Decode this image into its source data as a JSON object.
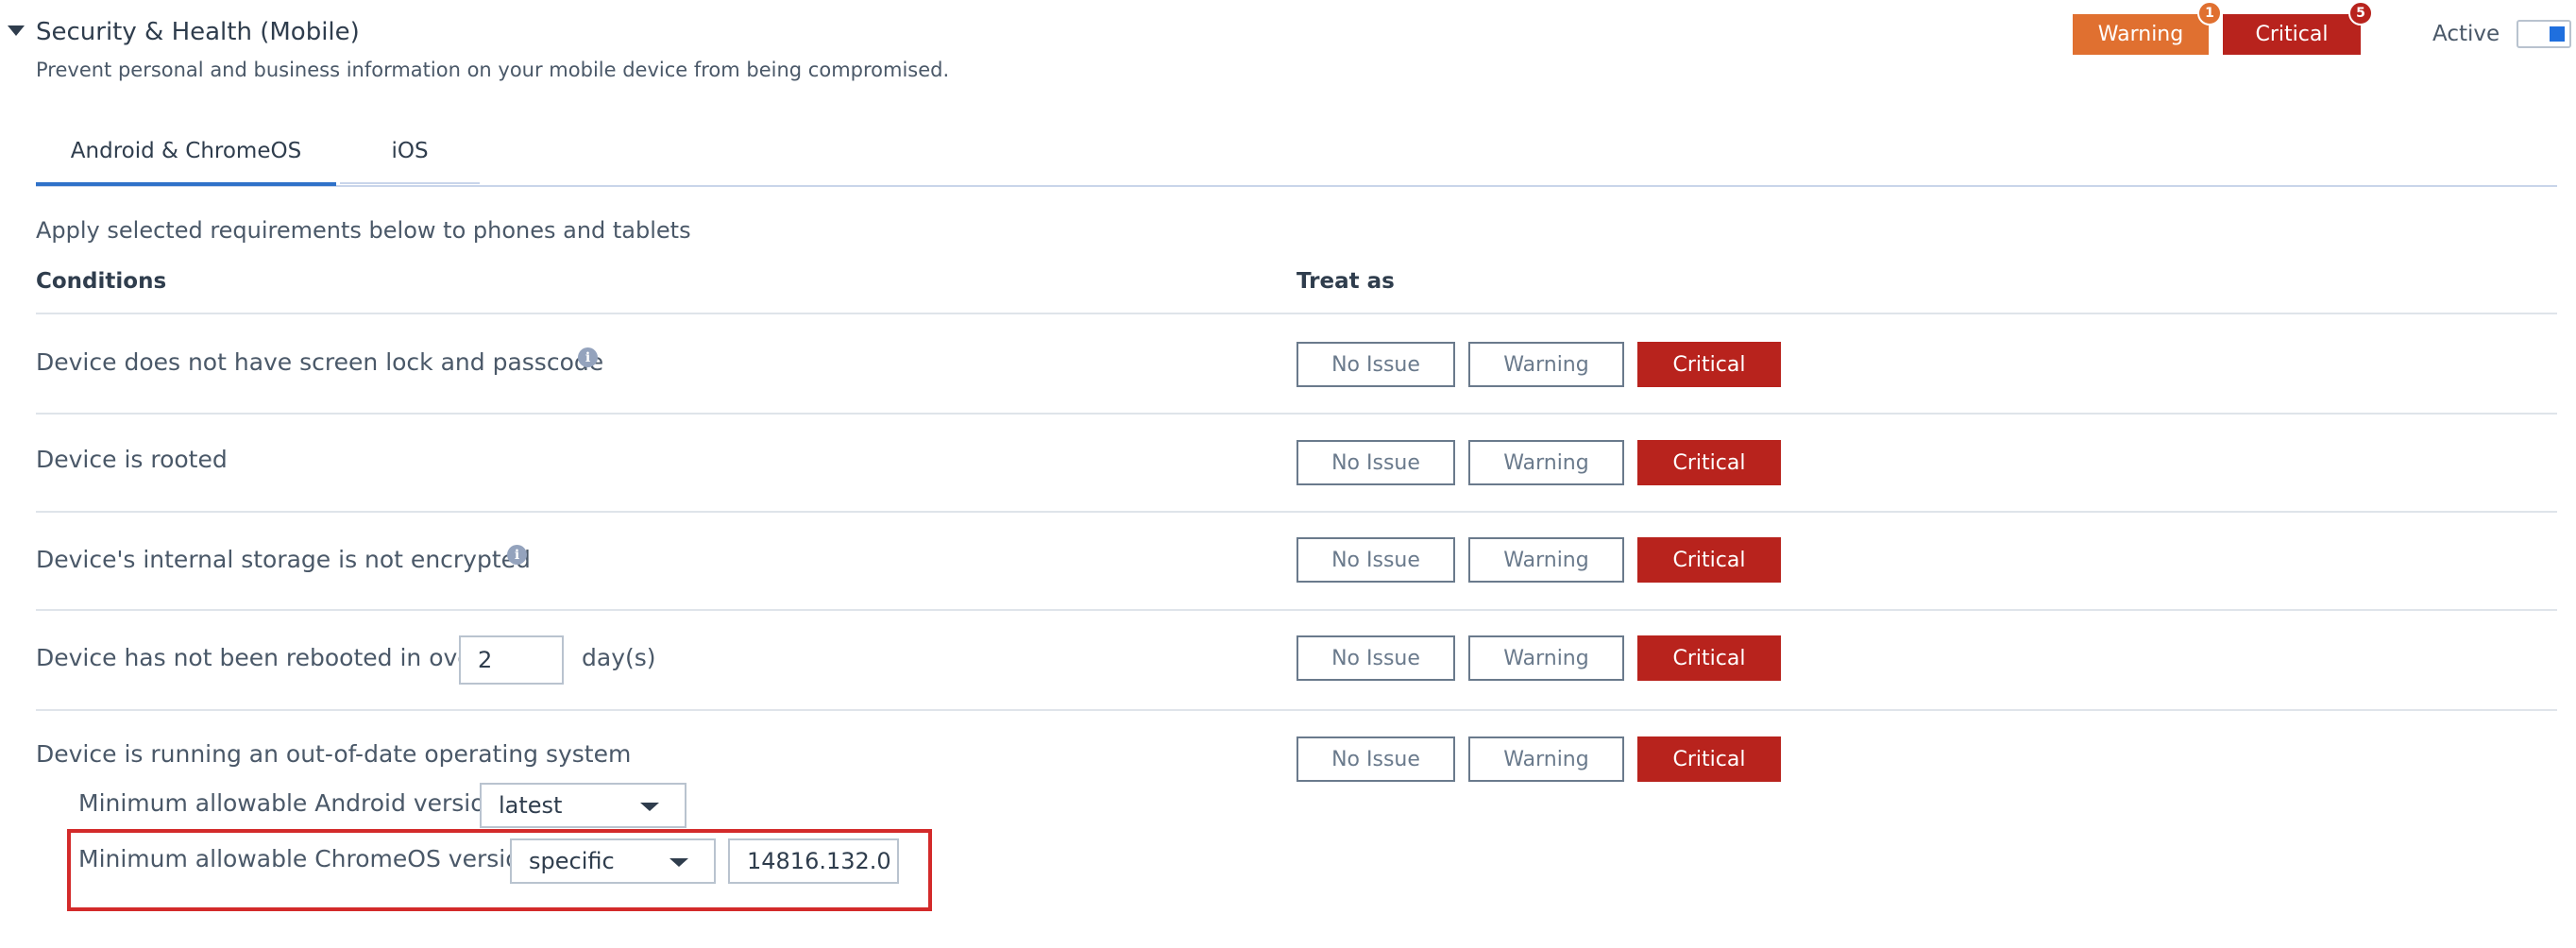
{
  "section": {
    "title": "Security & Health (Mobile)",
    "description": "Prevent personal and business information on your mobile device from being compromised."
  },
  "summary": {
    "warning_label": "Warning",
    "warning_count": "1",
    "critical_label": "Critical",
    "critical_count": "5",
    "active_label": "Active",
    "active_on": true
  },
  "tabs": [
    {
      "label": "Android & ChromeOS",
      "selected": true
    },
    {
      "label": "iOS",
      "selected": false
    }
  ],
  "apply_text": "Apply selected requirements below to phones and tablets",
  "columns": {
    "conditions": "Conditions",
    "treat_as": "Treat as"
  },
  "treat_options": {
    "no_issue": "No Issue",
    "warning": "Warning",
    "critical": "Critical"
  },
  "conditions": [
    {
      "label": "Device does not have screen lock and passcode",
      "selected": "Critical"
    },
    {
      "label": "Device is rooted",
      "selected": "Critical"
    },
    {
      "label": "Device's internal storage is not encrypted",
      "selected": "Critical"
    },
    {
      "label": "Device has not been rebooted in over",
      "days_value": "2",
      "days_unit": "day(s)",
      "selected": "Critical"
    },
    {
      "label": "Device is running an out-of-date operating system",
      "selected": "Critical",
      "android_label": "Minimum allowable Android version",
      "android_value": "latest",
      "chromeos_label": "Minimum allowable ChromeOS version",
      "chromeos_value": "specific",
      "chromeos_version": "14816.132.0"
    }
  ],
  "colors": {
    "warning": "#e07030",
    "critical": "#b8231d",
    "tab_accent": "#2f72c9",
    "highlight": "#d32a2a",
    "toggle_accent": "#1f6fde"
  },
  "icons": {
    "collapse": "caret-down-icon",
    "info": "info-icon",
    "dropdown": "chevron-down-icon"
  }
}
